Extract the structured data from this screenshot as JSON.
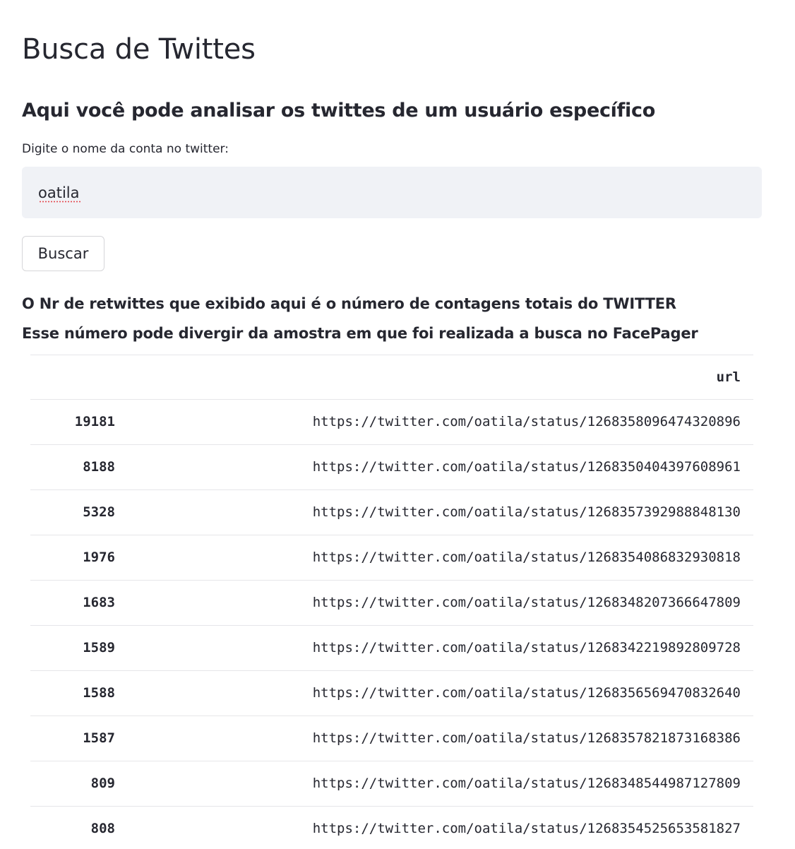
{
  "title": "Busca de Twittes",
  "subtitle": "Aqui você pode analisar os twittes de um usuário específico",
  "input": {
    "label": "Digite o nome da conta no twitter:",
    "value": "oatila"
  },
  "button": {
    "label": "Buscar"
  },
  "notes": [
    "O Nr de retwittes que exibido aqui é o número de contagens totais do TWITTER",
    "Esse número pode divergir da amostra em que foi realizada a busca no FacePager"
  ],
  "table": {
    "columns": [
      "",
      "url"
    ],
    "rows": [
      {
        "index": "19181",
        "url": "https://twitter.com/oatila/status/1268358096474320896"
      },
      {
        "index": "8188",
        "url": "https://twitter.com/oatila/status/1268350404397608961"
      },
      {
        "index": "5328",
        "url": "https://twitter.com/oatila/status/1268357392988848130"
      },
      {
        "index": "1976",
        "url": "https://twitter.com/oatila/status/1268354086832930818"
      },
      {
        "index": "1683",
        "url": "https://twitter.com/oatila/status/1268348207366647809"
      },
      {
        "index": "1589",
        "url": "https://twitter.com/oatila/status/1268342219892809728"
      },
      {
        "index": "1588",
        "url": "https://twitter.com/oatila/status/1268356569470832640"
      },
      {
        "index": "1587",
        "url": "https://twitter.com/oatila/status/1268357821873168386"
      },
      {
        "index": "809",
        "url": "https://twitter.com/oatila/status/1268348544987127809"
      },
      {
        "index": "808",
        "url": "https://twitter.com/oatila/status/1268354525653581827"
      }
    ]
  }
}
